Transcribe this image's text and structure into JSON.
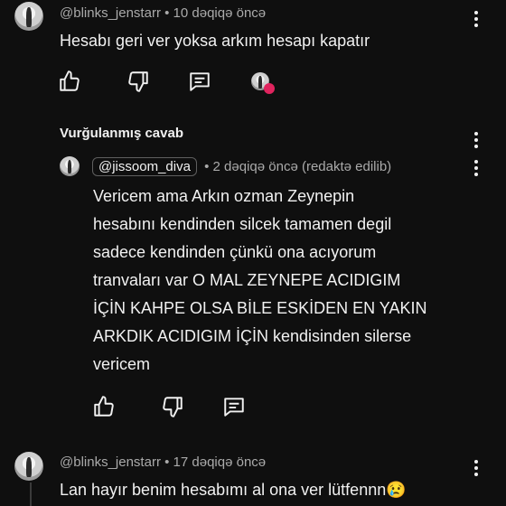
{
  "comments": [
    {
      "author": "@blinks_jenstarr",
      "time": "10 dəqiqə öncə",
      "text": "Hesabı geri ver yoksa arkım hesapı kapatır"
    },
    {
      "section_label": "Vurğulanmış cavab",
      "mention": "@jissoom_diva",
      "time": "2 dəqiqə öncə (redaktə edilib)",
      "lines": [
        "Vericem ama Arkın ozman Zeynepin",
        "hesabını kendinden silcek tamamen degil",
        "sadece kendinden çünkü ona acıyorum",
        "tranvaları var O MAL ZEYNEPE ACIDIGIM",
        "İÇİN KAHPE OLSA BİLE ESKİDEN EN YAKIN",
        "ARKDIK ACIDIGIM İÇİN  kendisinden silerse",
        "vericem"
      ]
    },
    {
      "author": "@blinks_jenstarr",
      "time": "17 dəqiqə öncə",
      "text": "Lan hayır benim hesabımı al ona ver lütfennn😢"
    }
  ],
  "separator": "•",
  "icons": {
    "like": "thumbs-up-icon",
    "dislike": "thumbs-down-icon",
    "reply": "reply-comment-icon",
    "more": "more-vert-icon",
    "creator_heart": "creator-heart-icon"
  },
  "colors": {
    "background": "#0f0f0f",
    "text": "#f1f1f1",
    "meta": "#aaaaaa",
    "heart": "#e0245e"
  }
}
